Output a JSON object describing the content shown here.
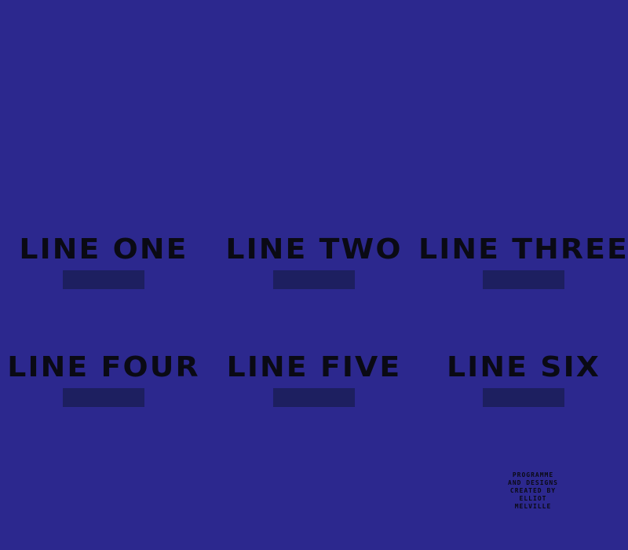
{
  "menu": {
    "lines": [
      {
        "label": "LINE ONE"
      },
      {
        "label": "LINE TWO"
      },
      {
        "label": "LINE THREE"
      },
      {
        "label": "LINE FOUR"
      },
      {
        "label": "LINE FIVE"
      },
      {
        "label": "LINE SIX"
      }
    ]
  },
  "credits": {
    "lines": [
      "PROGRAMME",
      "AND DESIGNS",
      "CREATED BY",
      "ELLIOT",
      "MELVILLE"
    ]
  },
  "colors": {
    "background": "#2c288e",
    "text": "#0a0a14",
    "button": "#1d1f60"
  }
}
